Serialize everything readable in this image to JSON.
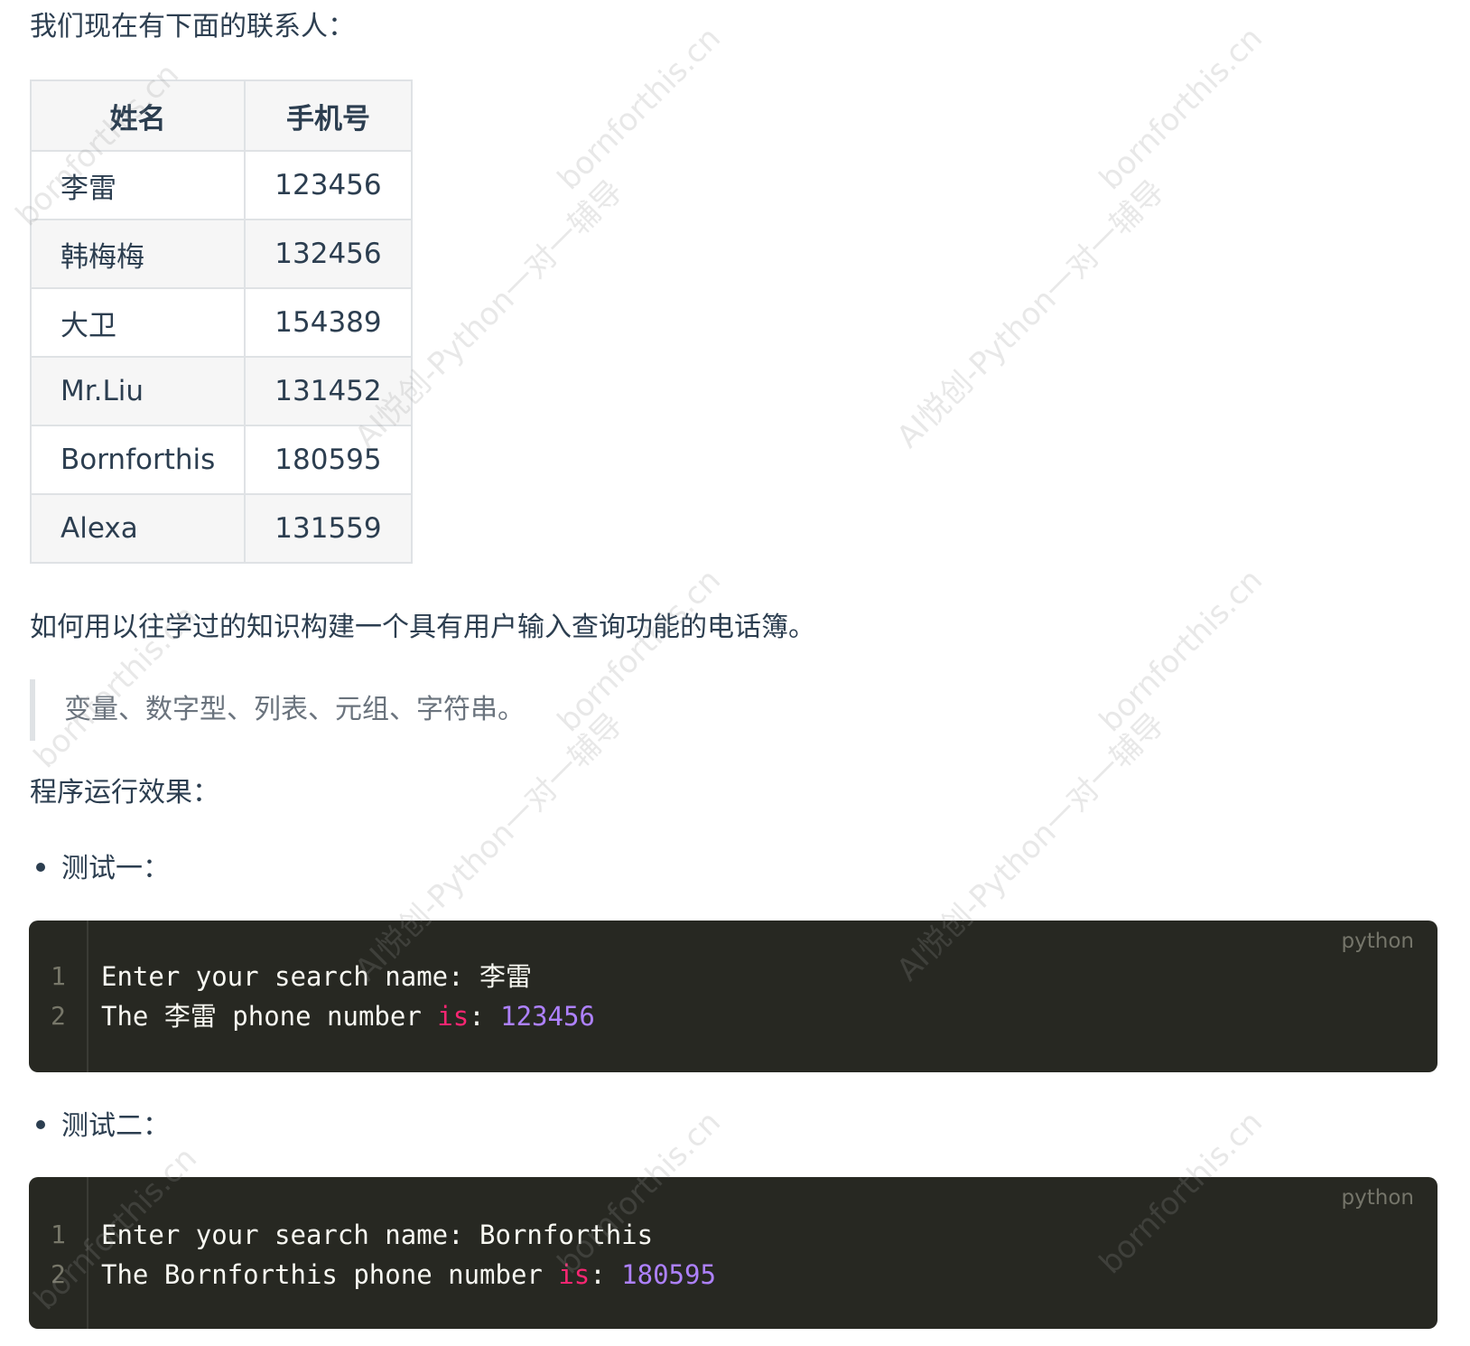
{
  "intro": "我们现在有下面的联系人：",
  "table": {
    "headers": [
      "姓名",
      "手机号"
    ],
    "rows": [
      {
        "name": "李雷",
        "phone": "123456"
      },
      {
        "name": "韩梅梅",
        "phone": "132456"
      },
      {
        "name": "大卫",
        "phone": "154389"
      },
      {
        "name": "Mr.Liu",
        "phone": "131452"
      },
      {
        "name": "Bornforthis",
        "phone": "180595"
      },
      {
        "name": "Alexa",
        "phone": "131559"
      }
    ]
  },
  "question": "如何用以往学过的知识构建一个具有用户输入查询功能的电话簿。",
  "quote": "变量、数字型、列表、元组、字符串。",
  "result_heading": "程序运行效果：",
  "tests": [
    {
      "label": "测试一：",
      "lang": "python",
      "line_numbers": [
        "1",
        "2"
      ],
      "line1": "Enter your search name: 李雷",
      "line2_prefix": "The 李雷 phone number ",
      "line2_keyword": "is",
      "line2_colon": ": ",
      "line2_number": "123456"
    },
    {
      "label": "测试二：",
      "lang": "python",
      "line_numbers": [
        "1",
        "2"
      ],
      "line1": "Enter your search name: Bornforthis",
      "line2_prefix": "The Bornforthis phone number ",
      "line2_keyword": "is",
      "line2_colon": ": ",
      "line2_number": "180595"
    }
  ],
  "watermarks": {
    "site": "bornforthis.cn",
    "tutor": "AI悦创-Python一对一辅导"
  }
}
